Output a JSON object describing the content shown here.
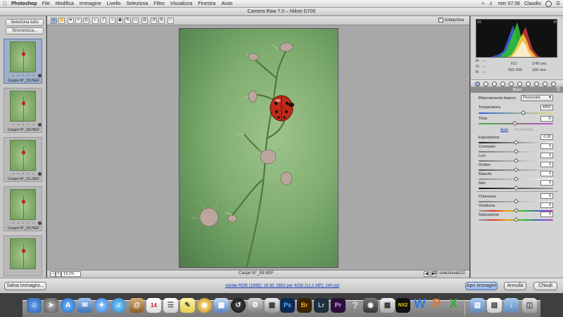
{
  "menubar": {
    "apple": "",
    "app": "Photoshop",
    "items": [
      "File",
      "Modifica",
      "Immagine",
      "Livello",
      "Seleziona",
      "Filtro",
      "Visualizza",
      "Finestra",
      "Aiuto"
    ],
    "clock": "mer 07:36",
    "user": "Claudio"
  },
  "window": {
    "title": "Camera Raw 7.0  –  Nikon D700"
  },
  "filmstrip": {
    "select_all": "Seleziona tutto",
    "sync": "Sincronizza...",
    "items": [
      {
        "name": "Caspri-N°_59.NEF",
        "selected": true,
        "stars": "• • • • •"
      },
      {
        "name": "Caspri-N°_60.NEF",
        "selected": false,
        "stars": "• • • • •"
      },
      {
        "name": "Caspri-N°_61.NEF",
        "selected": false,
        "stars": "• • • • •"
      },
      {
        "name": "Caspri-N°_62.NEF",
        "selected": false,
        "stars": "• • • • •"
      },
      {
        "name": "",
        "selected": false,
        "stars": ""
      }
    ]
  },
  "toolbar": {
    "tools": [
      {
        "icon": "zoom-icon",
        "glyph": "⌕"
      },
      {
        "icon": "hand-icon",
        "glyph": "✋"
      },
      {
        "icon": "white-balance-icon",
        "glyph": "✒"
      },
      {
        "icon": "color-sampler-icon",
        "glyph": "✧"
      },
      {
        "icon": "targeted-adjustment-icon",
        "glyph": "◎"
      },
      {
        "icon": "crop-icon",
        "glyph": "⌐"
      },
      {
        "icon": "straighten-icon",
        "glyph": "╱"
      },
      {
        "icon": "spot-removal-icon",
        "glyph": "○"
      },
      {
        "icon": "red-eye-icon",
        "glyph": "◉"
      },
      {
        "icon": "adjustment-brush-icon",
        "glyph": "✎"
      },
      {
        "icon": "graduated-filter-icon",
        "glyph": "▭"
      },
      {
        "icon": "preferences-icon",
        "glyph": "☰"
      },
      {
        "icon": "rotate-left-icon",
        "glyph": "↺"
      },
      {
        "icon": "rotate-right-icon",
        "glyph": "↻"
      },
      {
        "icon": "trash-icon",
        "glyph": "␡"
      }
    ],
    "preview_label": "Anteprima",
    "preview_checked": "✓"
  },
  "centerbar": {
    "zoom_minus": "–",
    "zoom_plus": "+",
    "zoom_value": "19,1%",
    "filename": "Caspri-N°_59.NEF",
    "count": "10 selezionati/10"
  },
  "histogram": {
    "r_label": "R:",
    "g_label": "G:",
    "b_label": "B:",
    "r": "---",
    "g": "---",
    "b": "---",
    "aperture": "f/11",
    "shutter": "1/40 sec",
    "iso": "ISO 200",
    "focal": "180 mm"
  },
  "panel": {
    "title": "Base",
    "wb_label": "Bilanciamento bianco:",
    "wb_value": "Personale",
    "temp_label": "Temperatura",
    "temp_value": "4850",
    "tint_label": "Tinta",
    "tint_value": "-6",
    "auto_label": "Auto",
    "default_label": "Predefinito",
    "rows": [
      {
        "label": "Esposizione",
        "value": "0,00"
      },
      {
        "label": "Contrasto",
        "value": "0"
      },
      {
        "label": "Luci",
        "value": "0"
      },
      {
        "label": "Ombre",
        "value": "0"
      },
      {
        "label": "Bianchi",
        "value": "0"
      },
      {
        "label": "Neri",
        "value": "0"
      },
      {
        "label": "Chiarezza",
        "value": "0"
      },
      {
        "label": "Vividezza",
        "value": "0"
      },
      {
        "label": "Saturazione",
        "value": "0"
      }
    ]
  },
  "bottombar": {
    "save": "Salva immagini...",
    "workflow": "Adobe RGB (1998); 16 bit; 2832 per 4256 (12,1 MP); 240 ppi",
    "open": "Apri immagini",
    "cancel": "Annulla",
    "done": "Chiudi"
  },
  "dock": {
    "labels": [
      "14",
      "Ps",
      "Br",
      "Lr",
      "Pr",
      "NX2",
      "W",
      "P",
      "X"
    ]
  },
  "colors": {
    "accent": "#8fb4ea",
    "photo_green": "#7fae6f",
    "ladybug_red": "#b72a1c"
  }
}
